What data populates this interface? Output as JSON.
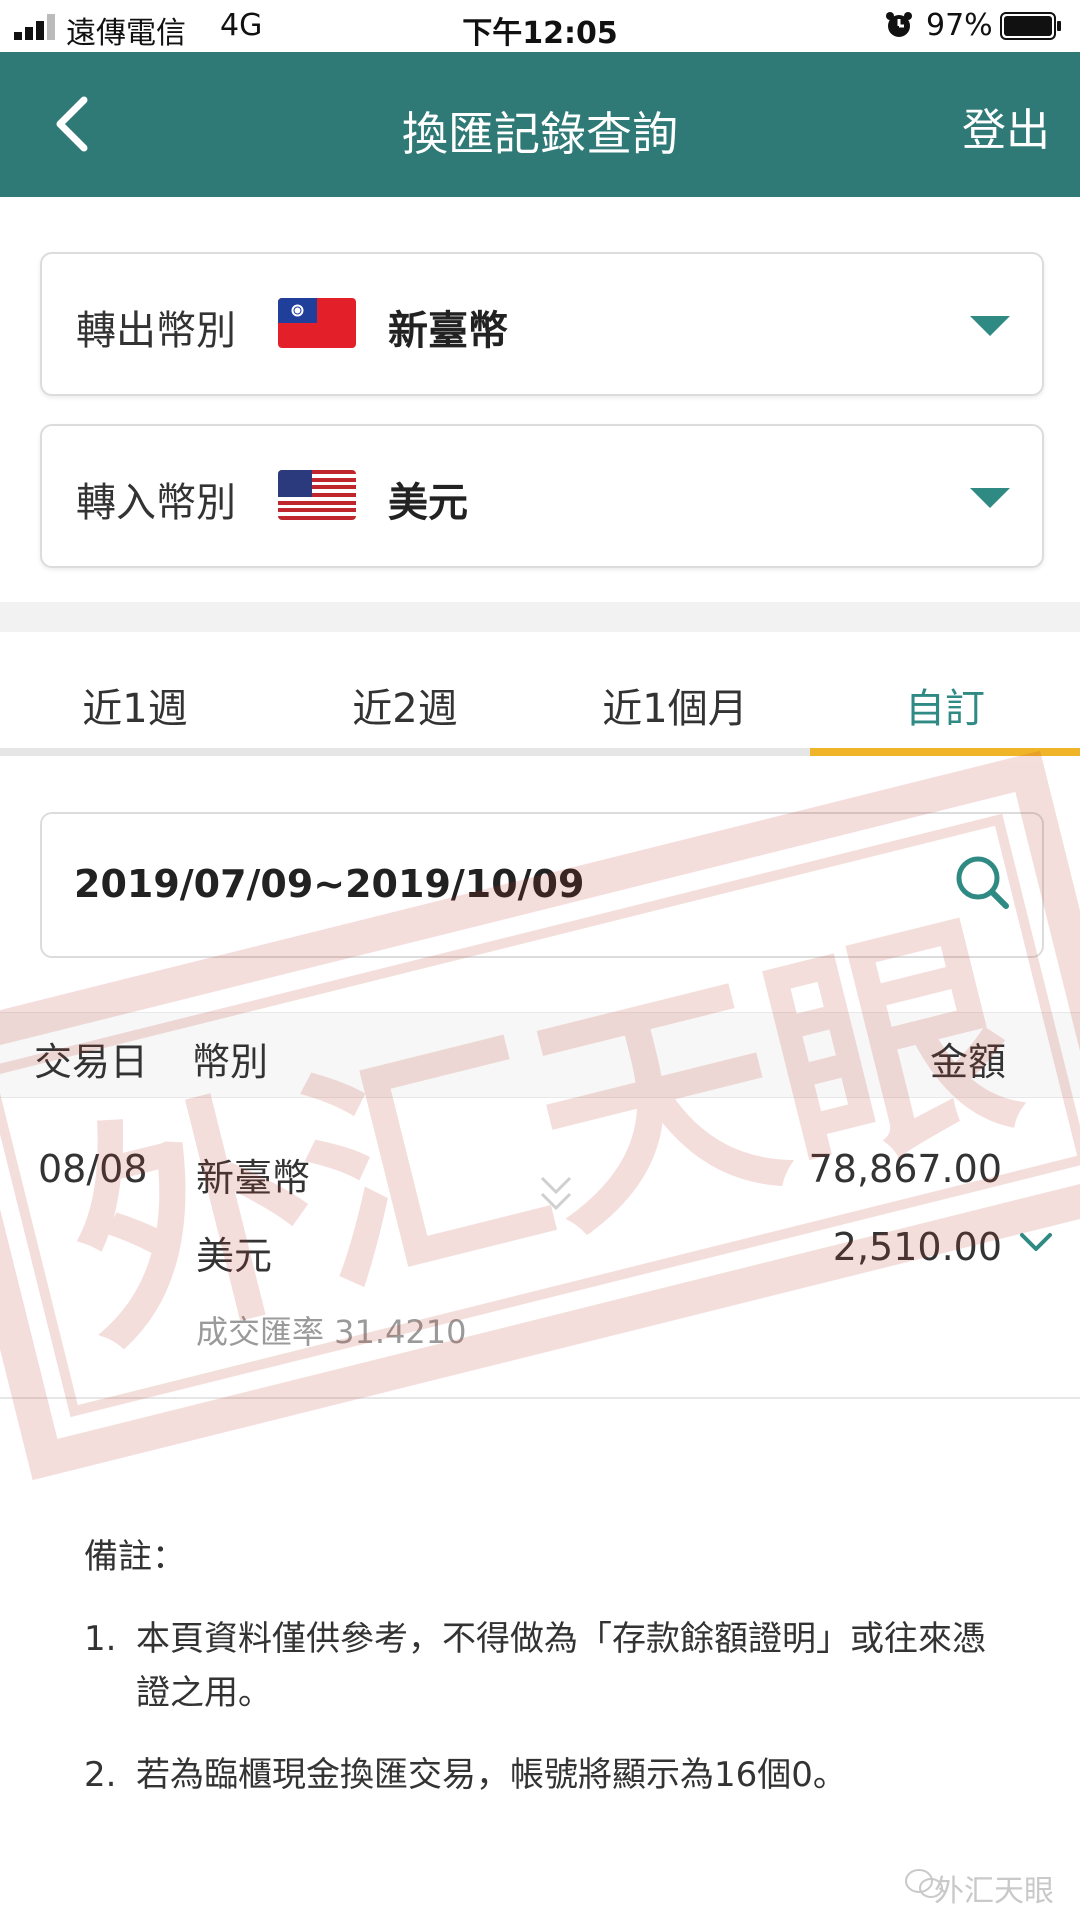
{
  "status_bar": {
    "carrier": "遠傳電信",
    "network": "4G",
    "time": "下午12:05",
    "battery": "97%"
  },
  "header": {
    "title": "換匯記錄查詢",
    "logout_label": "登出",
    "back_icon": "chevron-left-icon"
  },
  "from_currency": {
    "label": "轉出幣別",
    "value": "新臺幣",
    "flag": "taiwan-flag-icon"
  },
  "to_currency": {
    "label": "轉入幣別",
    "value": "美元",
    "flag": "us-flag-icon"
  },
  "tabs": [
    {
      "label": "近1週",
      "active": false
    },
    {
      "label": "近2週",
      "active": false
    },
    {
      "label": "近1個月",
      "active": false
    },
    {
      "label": "自訂",
      "active": true
    }
  ],
  "date_range": {
    "value": "2019/07/09~2019/10/09",
    "search_icon": "search-icon"
  },
  "table": {
    "headers": {
      "date": "交易日",
      "currency": "幣別",
      "amount": "金額"
    },
    "rows": [
      {
        "date": "08/08",
        "from_currency": "新臺幣",
        "from_amount": "78,867.00",
        "to_currency": "美元",
        "to_amount": "2,510.00",
        "rate_text": "成交匯率 31.4210"
      }
    ]
  },
  "notes": {
    "title": "備註：",
    "items": [
      {
        "num": "1.",
        "text": "本頁資料僅供參考，不得做為「存款餘額證明」或往來憑證之用。"
      },
      {
        "num": "2.",
        "text": "若為臨櫃現金換匯交易，帳號將顯示為16個0。"
      }
    ]
  },
  "watermark": {
    "text": "外汇天眼",
    "corner_text": "外汇天眼"
  },
  "colors": {
    "header": "#2f7a76",
    "accent": "#2f8a84",
    "tab_indicator": "#f0b429",
    "watermark": "#c0392b"
  }
}
